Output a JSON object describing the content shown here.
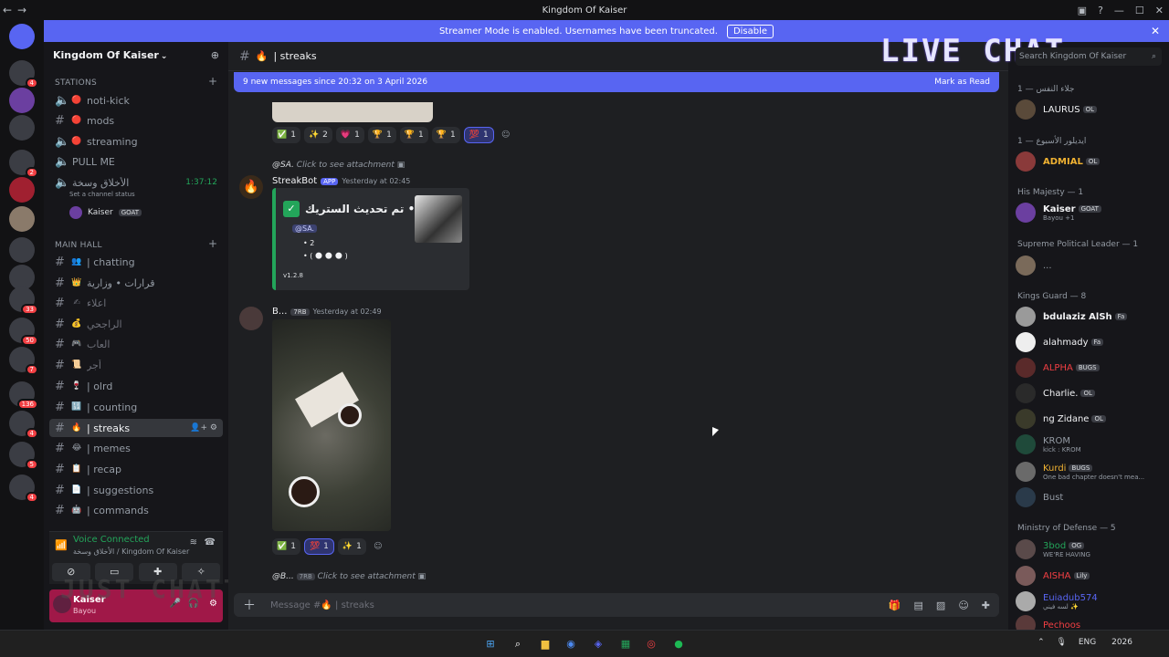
{
  "window": {
    "title": "Kingdom Of Kaiser"
  },
  "banner": {
    "text": "Streamer Mode is enabled. Usernames have been truncated.",
    "disable": "Disable"
  },
  "guild_badges": [
    "4",
    "2",
    "33",
    "50",
    "7",
    "136",
    "4",
    "5",
    "4"
  ],
  "server": {
    "name": "Kingdom Of Kaiser"
  },
  "channels_top": {
    "category": "STATIONS",
    "items": [
      {
        "name": "noti-kick",
        "emoji": "🔴"
      },
      {
        "name": "mods",
        "emoji": "🔴"
      },
      {
        "name": "streaming",
        "emoji": "🔴"
      },
      {
        "name": "PULL ME",
        "emoji": ""
      },
      {
        "name": "الأخلاق وسخة",
        "emoji": ""
      }
    ],
    "voice_timer": "1:37:12",
    "status_hint": "Set a channel status",
    "voice_user": "Kaiser",
    "voice_user_tag": "GOAT"
  },
  "main_hall": {
    "category": "MAIN HALL",
    "items": [
      {
        "name": "| chatting",
        "emoji": "👥"
      },
      {
        "name": "قرارات • وزارية",
        "emoji": "👑"
      },
      {
        "name": "اعلاء",
        "emoji": "✍"
      },
      {
        "name": "الراجحي",
        "emoji": "💰"
      },
      {
        "name": "العاب",
        "emoji": "🎮"
      },
      {
        "name": "أجر",
        "emoji": "📜"
      },
      {
        "name": "| olrd",
        "emoji": "🍷"
      },
      {
        "name": "| counting",
        "emoji": "🔢"
      },
      {
        "name": "| streaks",
        "emoji": "🔥"
      },
      {
        "name": "| memes",
        "emoji": "😂"
      },
      {
        "name": "| recap",
        "emoji": "📋"
      },
      {
        "name": "| suggestions",
        "emoji": "📄"
      },
      {
        "name": "| commands",
        "emoji": "🤖"
      }
    ]
  },
  "voice": {
    "status": "Voice Connected",
    "sub": "الأخلاق وسخة / Kingdom Of Kaiser"
  },
  "user": {
    "name": "Kaiser",
    "sub": "Bayou"
  },
  "chat": {
    "channel": "| streaks",
    "new_messages": "9 new messages since 20:32 on 3 April 2026",
    "mark_read": "Mark as Read",
    "reactions1": [
      {
        "e": "✅",
        "c": "1"
      },
      {
        "e": "✨",
        "c": "2"
      },
      {
        "e": "💗",
        "c": "1"
      },
      {
        "e": "🏆",
        "c": "1"
      },
      {
        "e": "🏆",
        "c": "1"
      },
      {
        "e": "🏆",
        "c": "1"
      },
      {
        "e": "💯",
        "c": "1"
      }
    ],
    "msg1": {
      "reply_user": "@SA.",
      "reply_text": "Click to see attachment",
      "author": "StreakBot",
      "app": "APP",
      "time": "Yesterday at 02:45",
      "embed_title": "تم تحديث الستريك •",
      "mention": "@SA.",
      "line2": "• 2",
      "line3": "• ( 🌑 🌑 🌑 )",
      "version": "v1.2.8"
    },
    "msg2": {
      "author": "B...",
      "tag": "7RB",
      "time": "Yesterday at 02:49"
    },
    "reactions2": [
      {
        "e": "✅",
        "c": "1"
      },
      {
        "e": "💯",
        "c": "1"
      },
      {
        "e": "✨",
        "c": "1"
      }
    ],
    "msg3": {
      "reply_user": "@B...",
      "tag": "7RB",
      "reply_text": "Click to see attachment"
    },
    "composer_placeholder": "Message #🔥 | streaks"
  },
  "members": {
    "search_placeholder": "Search Kingdom Of Kaiser",
    "overlay": "LIVE CHAT",
    "groups": [
      {
        "title": "جلاء النفس — 1"
      },
      {
        "title": "ايديلور الأسبوع — 1"
      },
      {
        "title": "His Majesty — 1"
      },
      {
        "title": "Supreme Political Leader — 1"
      },
      {
        "title": "Kings Guard — 8"
      },
      {
        "title": "Ministry of Defense — 5"
      }
    ],
    "list": [
      {
        "name": "LAURUS",
        "tag": "OL",
        "color": "#f2f3f5"
      },
      {
        "name": "ADMIAL",
        "tag": "OL",
        "color": "#f0b232"
      },
      {
        "name": "Kaiser",
        "tag": "GOAT",
        "sub": "Bayou +1",
        "color": "#f2f3f5"
      },
      {
        "name": "...",
        "tag": "",
        "color": "#949ba4"
      },
      {
        "name": "bdulaziz AlSh",
        "tag": "Fa",
        "color": "#f2f3f5"
      },
      {
        "name": "alahmady",
        "tag": "Fa",
        "color": "#f2f3f5"
      },
      {
        "name": "ALPHA",
        "tag": "BUGS",
        "color": "#f23f43"
      },
      {
        "name": "Charlie.",
        "tag": "OL",
        "color": "#f2f3f5"
      },
      {
        "name": "ng Zidane",
        "tag": "OL",
        "color": "#f2f3f5"
      },
      {
        "name": "KROM",
        "tag": "",
        "sub": "kick : KROM",
        "color": "#949ba4"
      },
      {
        "name": "Kurdi",
        "tag": "BUGS",
        "sub": "One bad chapter doesn't mea...",
        "color": "#f0b232"
      },
      {
        "name": "Bust",
        "tag": "",
        "color": "#949ba4"
      },
      {
        "name": "3bod",
        "tag": "OG",
        "sub": "WE'RE HAVING",
        "color": "#23a55a"
      },
      {
        "name": "AISHA",
        "tag": "Lily",
        "color": "#f23f43"
      },
      {
        "name": "Euiadub574",
        "tag": "",
        "sub": "لسه فيني ✨",
        "color": "#5865f2"
      },
      {
        "name": "Pechoos",
        "tag": "",
        "color": "#f23f43"
      }
    ]
  },
  "overlay_left": "JUST CHATTING",
  "tray": {
    "lang": "ENG",
    "date": "2026"
  }
}
